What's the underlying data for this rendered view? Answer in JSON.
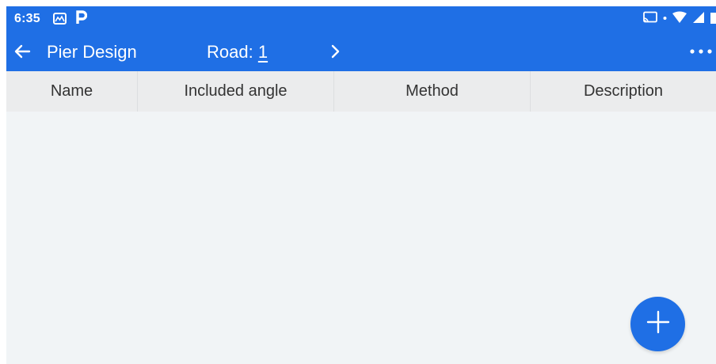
{
  "status_bar": {
    "time": "6:35",
    "left_icons": [
      "mountain-app-icon",
      "p-app-icon"
    ],
    "right_icons": [
      "cast-icon",
      "dot-icon",
      "wifi-icon",
      "signal-icon",
      "battery-icon"
    ]
  },
  "toolbar": {
    "title": "Pier Design",
    "road_label": "Road:",
    "road_value": "1",
    "back_icon": "arrow-left-icon",
    "next_icon": "chevron-right-icon",
    "more_icon": "more-horizontal-icon"
  },
  "table": {
    "columns": [
      "Name",
      "Included angle",
      "Method",
      "Description"
    ],
    "rows": []
  },
  "fab": {
    "icon": "plus-icon"
  },
  "colors": {
    "primary": "#1f6fe5",
    "header_bg": "#ebeced",
    "body_bg": "#f1f4f6"
  }
}
